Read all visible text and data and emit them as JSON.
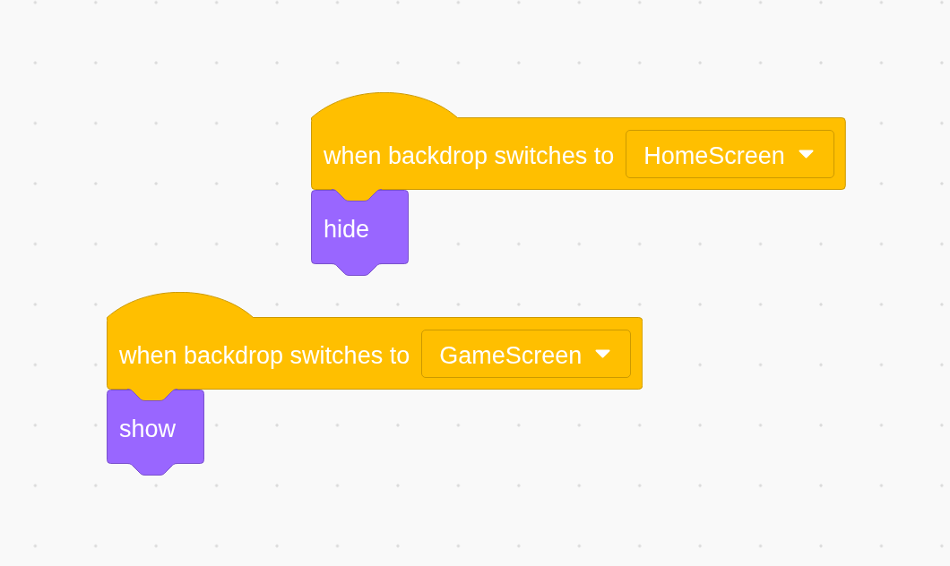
{
  "scripts": [
    {
      "blocks": [
        {
          "kind": "hat",
          "color": "#ffbf00",
          "text": "when backdrop switches to",
          "dropdown": "HomeScreen"
        },
        {
          "kind": "stack",
          "color": "#9966ff",
          "text": "hide"
        }
      ]
    },
    {
      "blocks": [
        {
          "kind": "hat",
          "color": "#ffbf00",
          "text": "when backdrop switches to",
          "dropdown": "GameScreen"
        },
        {
          "kind": "stack",
          "color": "#9966ff",
          "text": "show"
        }
      ]
    }
  ]
}
